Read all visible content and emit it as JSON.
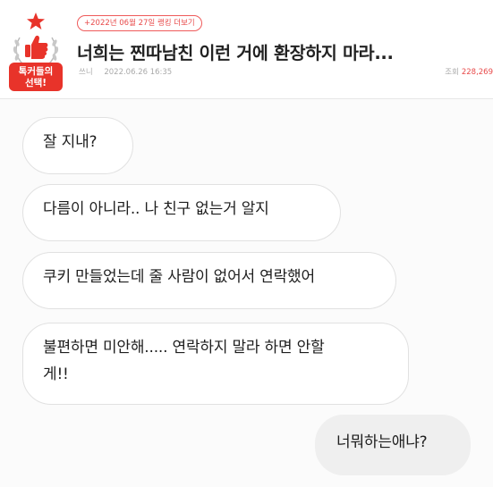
{
  "header": {
    "badge": {
      "line1": "톡커들의",
      "line2": "선택!"
    },
    "ranking_link": "+2022년 06월 27일 랭킹 더보기",
    "title": "너희는 찐따남친 이런 거에 환장하지 마라...",
    "author": "쓰니",
    "date": "2022.06.26 16:35",
    "views_label": "조회",
    "views_count": "228,269",
    "colors": {
      "accent": "#e84b4b",
      "badge_red": "#e8332a"
    }
  },
  "chat": {
    "messages": [
      {
        "side": "received",
        "text": "잘 지내?"
      },
      {
        "side": "received",
        "text": "다름이 아니라.. 나 친구 없는거 알지"
      },
      {
        "side": "received",
        "text": "쿠키 만들었는데 줄 사람이 없어서 연락했어"
      },
      {
        "side": "received",
        "line1": "불편하면 미안해..... 연락하지 말라 하면 안할",
        "line2": "게!!"
      },
      {
        "side": "sent",
        "text": "너뭐하는애냐?"
      }
    ]
  }
}
